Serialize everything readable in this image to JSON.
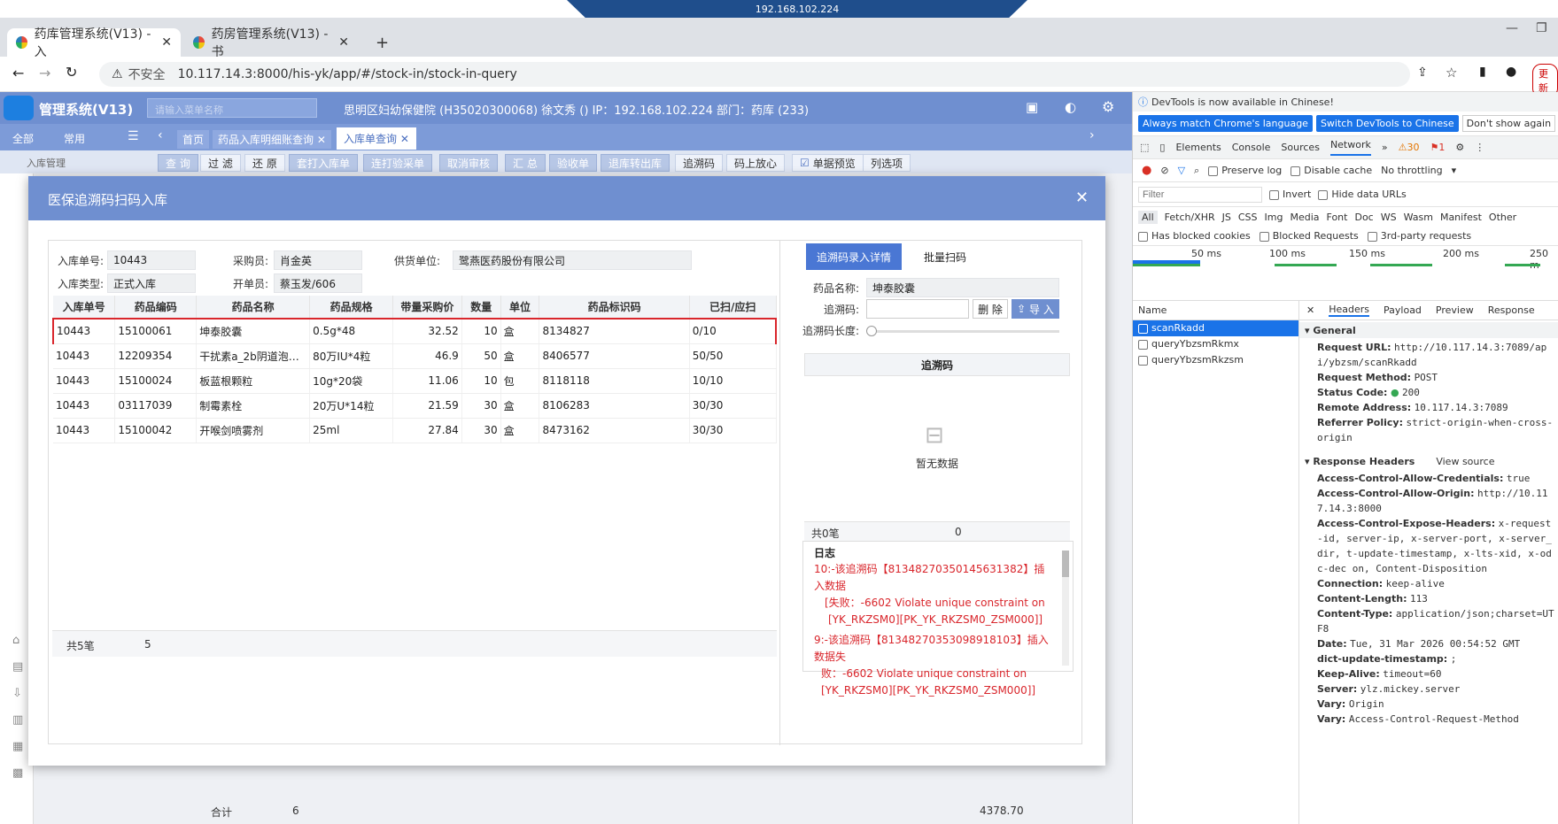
{
  "remote": {
    "ip": "192.168.102.224"
  },
  "browser": {
    "tabs": [
      {
        "title": "药库管理系统(V13) - 入"
      },
      {
        "title": "药房管理系统(V13) - 书"
      }
    ],
    "new_tab": "+",
    "insecure": "不安全",
    "url": "10.117.14.3:8000/his-yk/app/#/stock-in/stock-in-query",
    "update_btn": "更新"
  },
  "app": {
    "title": "管理系统(V13)",
    "search_placeholder": "请输入菜单名称",
    "user_info": "思明区妇幼保健院 (H35020300068) 徐文秀 () IP：192.168.102.224 部门：药库 (233)",
    "nav_tabs": {
      "all": "全部",
      "common": "常用",
      "home": "首页",
      "detail": "药品入库明细账查询",
      "query": "入库单查询"
    },
    "left_menu": "入库管理",
    "toolbar": [
      "查 询",
      "过 滤",
      "还 原",
      "套打入库单",
      "连打验采单",
      "取消审核",
      "汇 总",
      "验收单",
      "退库转出库",
      "追溯码",
      "码上放心",
      "单据预览",
      "列选项"
    ],
    "bottom": {
      "label": "合计",
      "count": "6",
      "amount": "4378.70"
    }
  },
  "modal": {
    "title": "医保追溯码扫码入库",
    "form": {
      "order_no_label": "入库单号:",
      "order_no": "10443",
      "buyer_label": "采购员:",
      "buyer": "肖金英",
      "supplier_label": "供货单位:",
      "supplier": "鹭燕医药股份有限公司",
      "type_label": "入库类型:",
      "type": "正式入库",
      "maker_label": "开单员:",
      "maker": "蔡玉发/606"
    },
    "table": {
      "headers": [
        "入库单号",
        "药品编码",
        "药品名称",
        "药品规格",
        "带量采购价",
        "数量",
        "单位",
        "药品标识码",
        "已扫/应扫"
      ],
      "rows": [
        [
          "10443",
          "15100061",
          "坤泰胶囊",
          "0.5g*48",
          "32.52",
          "10",
          "盒",
          "8134827",
          "0/10"
        ],
        [
          "10443",
          "12209354",
          "干扰素a_2b阴道泡…",
          "80万IU*4粒",
          "46.9",
          "50",
          "盒",
          "8406577",
          "50/50"
        ],
        [
          "10443",
          "15100024",
          "板蓝根颗粒",
          "10g*20袋",
          "11.06",
          "10",
          "包",
          "8118118",
          "10/10"
        ],
        [
          "10443",
          "03117039",
          "制霉素栓",
          "20万U*14粒",
          "21.59",
          "30",
          "盒",
          "8106283",
          "30/30"
        ],
        [
          "10443",
          "15100042",
          "开喉剑喷雾剂",
          "25ml",
          "27.84",
          "30",
          "盒",
          "8473162",
          "30/30"
        ]
      ],
      "footer_label": "共5笔",
      "footer_count": "5"
    },
    "right": {
      "tab_detail": "追溯码录入详情",
      "tab_batch": "批量扫码",
      "drug_name_label": "药品名称:",
      "drug_name": "坤泰胶囊",
      "code_label": "追溯码:",
      "delete_btn": "删 除",
      "import_btn": "导 入",
      "length_label": "追溯码长度:",
      "code_col": "追溯码",
      "empty": "暂无数据",
      "footer_label": "共0笔",
      "footer_count": "0"
    },
    "log": {
      "title": "日志",
      "lines": [
        "10:-该追溯码【81348270350145631382】插入数据",
        "[失败：-6602 Violate unique constraint on",
        "[YK_RKZSM0][PK_YK_RKZSM0_ZSM000]]",
        "9:-该追溯码【81348270353098918103】插入数据失",
        "败：-6602 Violate unique constraint on",
        "[YK_RKZSM0][PK_YK_RKZSM0_ZSM000]]"
      ]
    }
  },
  "devtools": {
    "banner": "DevTools is now available in Chinese!",
    "btn_match": "Always match Chrome's language",
    "btn_switch": "Switch DevTools to Chinese",
    "btn_dont": "Don't show again",
    "tabs": [
      "Elements",
      "Console",
      "Sources",
      "Network"
    ],
    "warn_count": "30",
    "err_count": "1",
    "preserve_log": "Preserve log",
    "disable_cache": "Disable cache",
    "throttling": "No throttling",
    "filter_placeholder": "Filter",
    "invert": "Invert",
    "hide_data": "Hide data URLs",
    "types": [
      "All",
      "Fetch/XHR",
      "JS",
      "CSS",
      "Img",
      "Media",
      "Font",
      "Doc",
      "WS",
      "Wasm",
      "Manifest",
      "Other"
    ],
    "blocked_cookies": "Has blocked cookies",
    "blocked_requests": "Blocked Requests",
    "third_party": "3rd-party requests",
    "timeline": [
      "50 ms",
      "100 ms",
      "150 ms",
      "200 ms",
      "250 m"
    ],
    "name_col": "Name",
    "requests": [
      "scanRkadd",
      "queryYbzsmRkmx",
      "queryYbzsmRkzsm"
    ],
    "detail_tabs": [
      "Headers",
      "Payload",
      "Preview",
      "Response"
    ],
    "general": "General",
    "request_url_label": "Request URL:",
    "request_url": "http://10.117.14.3:7089/api/ybzsm/scanRkadd",
    "method_label": "Request Method:",
    "method": "POST",
    "status_label": "Status Code:",
    "status": "200",
    "remote_label": "Remote Address:",
    "remote": "10.117.14.3:7089",
    "referrer_label": "Referrer Policy:",
    "referrer": "strict-origin-when-cross-origin",
    "resp_headers": "Response Headers",
    "view_source": "View source",
    "headers": [
      {
        "k": "Access-Control-Allow-Credentials:",
        "v": "true"
      },
      {
        "k": "Access-Control-Allow-Origin:",
        "v": "http://10.117.14.3:8000"
      },
      {
        "k": "Access-Control-Expose-Headers:",
        "v": "x-request-id, server-ip, x-server-port, x-server_dir, t-update-timestamp, x-lts-xid, x-odc-dec on, Content-Disposition"
      },
      {
        "k": "Connection:",
        "v": "keep-alive"
      },
      {
        "k": "Content-Length:",
        "v": "113"
      },
      {
        "k": "Content-Type:",
        "v": "application/json;charset=UTF8"
      },
      {
        "k": "Date:",
        "v": "Tue, 31 Mar 2026 00:54:52 GMT"
      },
      {
        "k": "dict-update-timestamp:",
        "v": ";"
      },
      {
        "k": "Keep-Alive:",
        "v": "timeout=60"
      },
      {
        "k": "Server:",
        "v": "ylz.mickey.server"
      },
      {
        "k": "Vary:",
        "v": "Origin"
      },
      {
        "k": "Vary:",
        "v": "Access-Control-Request-Method"
      }
    ]
  }
}
